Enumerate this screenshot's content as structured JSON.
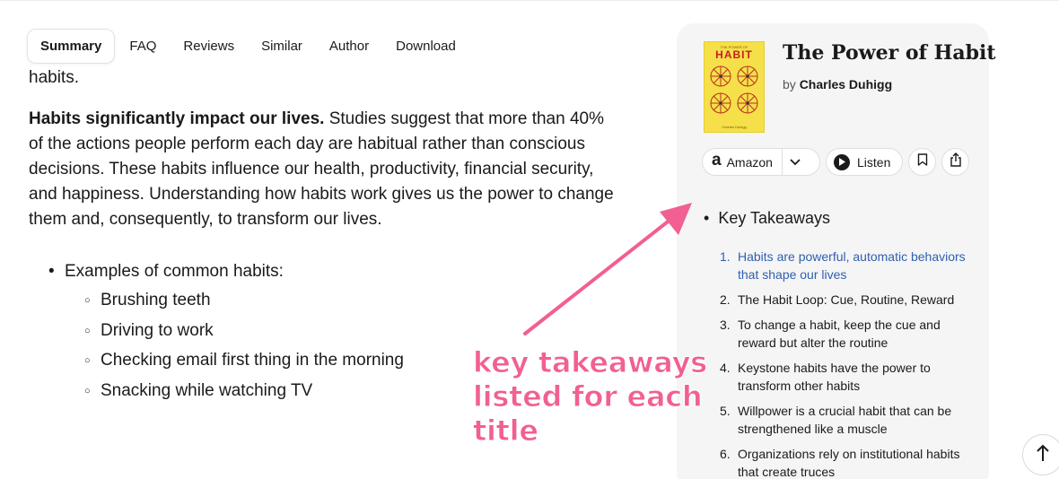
{
  "tabs": [
    "Summary",
    "FAQ",
    "Reviews",
    "Similar",
    "Author",
    "Download"
  ],
  "article": {
    "fragment": "habits.",
    "para_bold": "Habits significantly impact our lives.",
    "para_rest": " Studies suggest that more than 40% of the actions people perform each day are habitual rather than conscious decisions. These habits influence our health, productivity, financial security, and happiness. Understanding how habits work gives us the power to change them and, consequently, to transform our lives.",
    "list_label": "Examples of common habits:",
    "examples": [
      "Brushing teeth",
      "Driving to work",
      "Checking email first thing in the morning",
      "Snacking while watching TV"
    ]
  },
  "book": {
    "title": "The Power of Habit",
    "by": "by",
    "author": "Charles Duhigg",
    "cover": {
      "top_text": "THE POWER OF",
      "title_text": "HABIT",
      "author_text": "Charles Duhigg"
    }
  },
  "actions": {
    "amazon_logo": "a",
    "amazon_label": "Amazon",
    "listen_label": "Listen"
  },
  "key_takeaways": {
    "heading": "Key Takeaways",
    "items": [
      {
        "num": "1.",
        "text": "Habits are powerful, automatic behaviors that shape our lives"
      },
      {
        "num": "2.",
        "text": "The Habit Loop: Cue, Routine, Reward"
      },
      {
        "num": "3.",
        "text": "To change a habit, keep the cue and reward but alter the routine"
      },
      {
        "num": "4.",
        "text": "Keystone habits have the power to transform other habits"
      },
      {
        "num": "5.",
        "text": "Willpower is a crucial habit that can be strengthened like a muscle"
      },
      {
        "num": "6.",
        "text": "Organizations rely on institutional habits that create truces"
      }
    ]
  },
  "annotation": {
    "text": "key takeaways\nlisted for each\ntitle",
    "color": "#f25f93"
  },
  "colors": {
    "link_blue": "#2f5fae",
    "card_bg": "#f5f5f6",
    "cover_yellow": "#f6e04a"
  }
}
